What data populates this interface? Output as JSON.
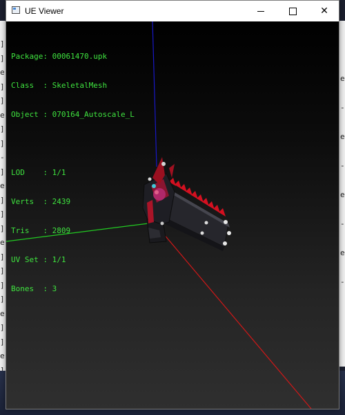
{
  "window": {
    "title": "UE Viewer",
    "controls": {
      "minimize_icon": "minimize-icon",
      "maximize_icon": "maximize-icon",
      "close_glyph": "✕"
    }
  },
  "info": {
    "package_label": "Package:",
    "package_value": "00061470.upk",
    "class_label": "Class  :",
    "class_value": "SkeletalMesh",
    "object_label": "Object :",
    "object_value": "070164_Autoscale_L",
    "lod_label": "LOD    :",
    "lod_value": "1/1",
    "verts_label": "Verts  :",
    "verts_value": "2439",
    "tris_label": "Tris   :",
    "tris_value": "2809",
    "uvset_label": "UV Set :",
    "uvset_value": "1/1",
    "bones_label": "Bones  :",
    "bones_value": "3"
  },
  "background": {
    "left_glyphs": [
      "]",
      "]",
      "e",
      "]",
      "]",
      "e",
      "]",
      "]",
      "-",
      "]",
      "e",
      "]",
      "]",
      "]",
      "e",
      "]",
      "]",
      "]",
      "]",
      "e",
      "]",
      "]",
      "e",
      "]"
    ],
    "right_glyphs": [
      "e",
      "-",
      "e",
      "-",
      "e",
      "-",
      "e",
      "-"
    ]
  },
  "colors": {
    "info_text": "#3fe43f",
    "axis_x": "#d01818",
    "axis_y": "#22cc22",
    "axis_z": "#1818c8"
  }
}
